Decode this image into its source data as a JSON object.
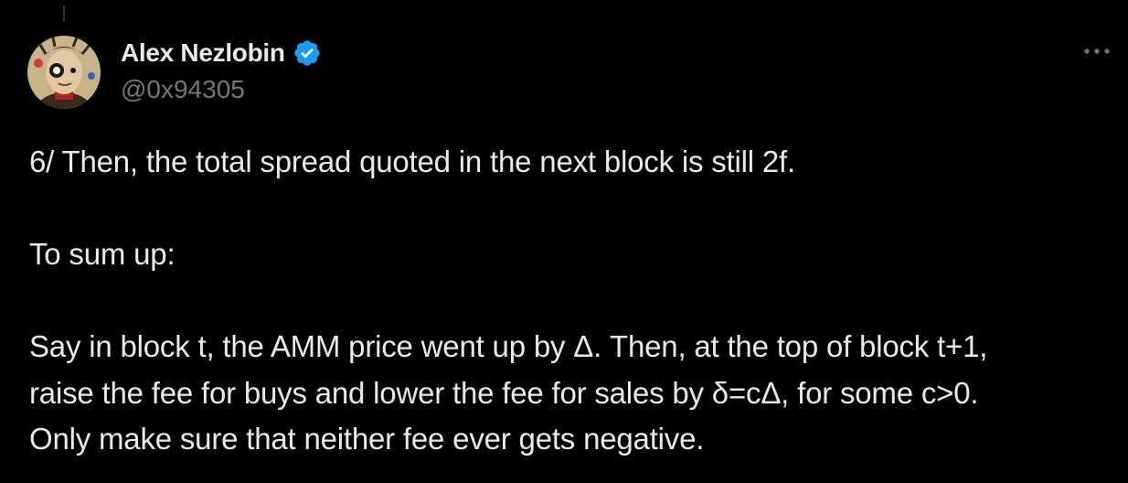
{
  "author": {
    "display_name": "Alex Nezlobin",
    "handle": "@0x94305",
    "verified": true
  },
  "tweet": {
    "lines": [
      "6/ Then, the total spread quoted in the next block is still 2f.",
      "",
      "To sum up:",
      "",
      "Say in block t, the AMM price went up by Δ. Then, at the top of block t+1,",
      "raise the fee for buys and lower the fee for sales by δ=cΔ, for some c>0.",
      "Only make sure that neither fee ever gets negative."
    ]
  },
  "icons": {
    "verified": "verified-badge-icon",
    "more": "more-options-icon"
  },
  "colors": {
    "background": "#000000",
    "text": "#e7e9ea",
    "secondary_text": "#71767b",
    "verified_blue": "#1d9bf0"
  }
}
